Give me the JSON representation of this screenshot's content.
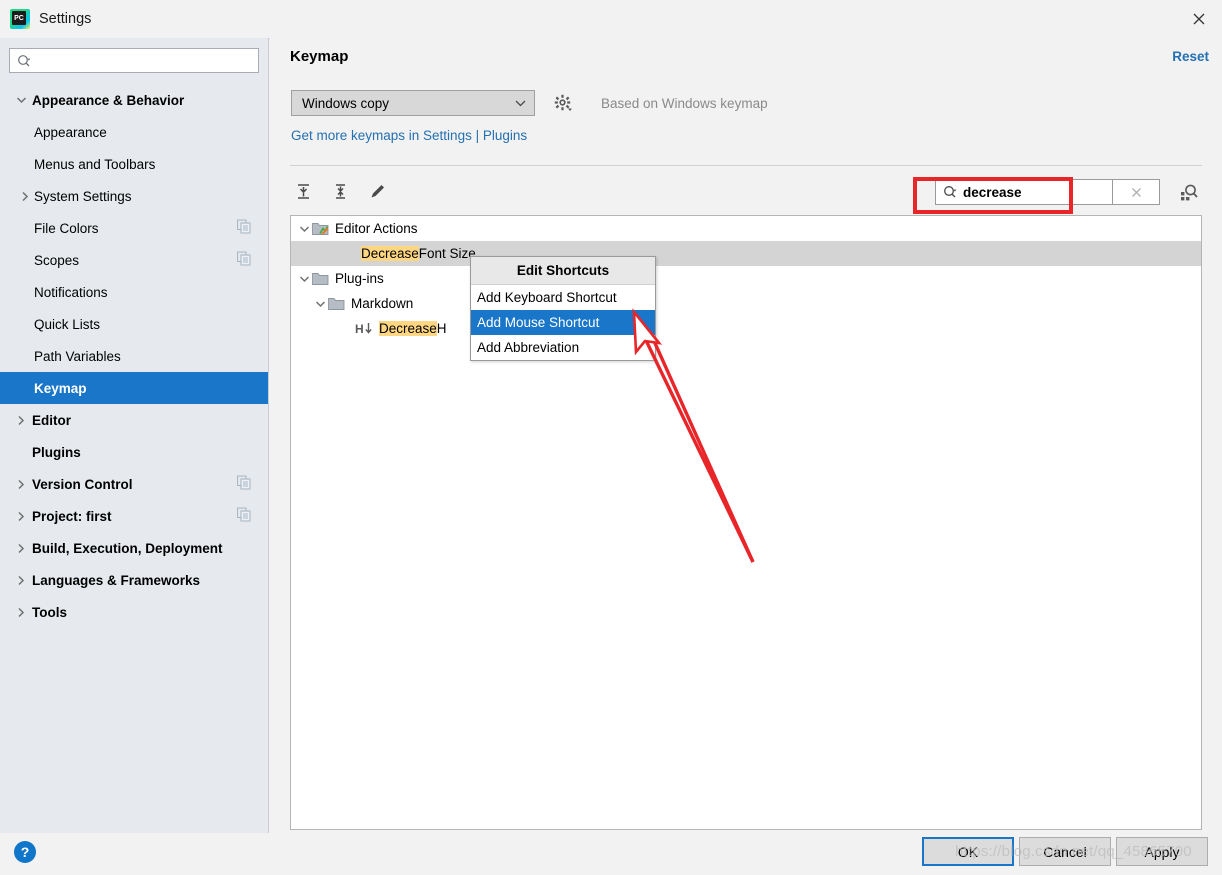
{
  "window": {
    "title": "Settings",
    "logo_icon": "pycharm-logo",
    "close_icon": "close-icon"
  },
  "sidebar": {
    "search": {
      "value": "",
      "placeholder": "",
      "icon": "search-icon"
    },
    "items": [
      {
        "label": "Appearance & Behavior",
        "level": 0,
        "bold": true,
        "arrow": "chevron-down",
        "selected": false,
        "badge": false
      },
      {
        "label": "Appearance",
        "level": 1,
        "bold": false,
        "arrow": "none",
        "selected": false,
        "badge": false
      },
      {
        "label": "Menus and Toolbars",
        "level": 1,
        "bold": false,
        "arrow": "none",
        "selected": false,
        "badge": false
      },
      {
        "label": "System Settings",
        "level": 1,
        "bold": false,
        "arrow": "chevron-right",
        "selected": false,
        "badge": false
      },
      {
        "label": "File Colors",
        "level": 1,
        "bold": false,
        "arrow": "none",
        "selected": false,
        "badge": true
      },
      {
        "label": "Scopes",
        "level": 1,
        "bold": false,
        "arrow": "none",
        "selected": false,
        "badge": true
      },
      {
        "label": "Notifications",
        "level": 1,
        "bold": false,
        "arrow": "none",
        "selected": false,
        "badge": false
      },
      {
        "label": "Quick Lists",
        "level": 1,
        "bold": false,
        "arrow": "none",
        "selected": false,
        "badge": false
      },
      {
        "label": "Path Variables",
        "level": 1,
        "bold": false,
        "arrow": "none",
        "selected": false,
        "badge": false
      },
      {
        "label": "Keymap",
        "level": 1,
        "bold": true,
        "arrow": "none",
        "selected": true,
        "badge": false
      },
      {
        "label": "Editor",
        "level": 0,
        "bold": true,
        "arrow": "chevron-right",
        "selected": false,
        "badge": false
      },
      {
        "label": "Plugins",
        "level": 0,
        "bold": true,
        "arrow": "none",
        "selected": false,
        "badge": false
      },
      {
        "label": "Version Control",
        "level": 0,
        "bold": true,
        "arrow": "chevron-right",
        "selected": false,
        "badge": true
      },
      {
        "label": "Project: first",
        "level": 0,
        "bold": true,
        "arrow": "chevron-right",
        "selected": false,
        "badge": true
      },
      {
        "label": "Build, Execution, Deployment",
        "level": 0,
        "bold": true,
        "arrow": "chevron-right",
        "selected": false,
        "badge": false
      },
      {
        "label": "Languages & Frameworks",
        "level": 0,
        "bold": true,
        "arrow": "chevron-right",
        "selected": false,
        "badge": false
      },
      {
        "label": "Tools",
        "level": 0,
        "bold": true,
        "arrow": "chevron-right",
        "selected": false,
        "badge": false
      }
    ]
  },
  "main": {
    "title": "Keymap",
    "reset_label": "Reset",
    "keymap_select": {
      "value": "Windows copy",
      "chevron_icon": "chevron-down-icon"
    },
    "gear_icon": "gear-icon",
    "based_on": "Based on Windows keymap",
    "plugins_link": "Get more keymaps in Settings | Plugins",
    "toolbar": [
      {
        "icon": "expand-all-icon"
      },
      {
        "icon": "collapse-all-icon"
      },
      {
        "icon": "edit-pencil-icon"
      }
    ],
    "find": {
      "value": "decrease",
      "search_icon": "search-icon",
      "clear_icon": "clear-x-icon",
      "shortcut_find_icon": "find-by-shortcut-icon"
    },
    "tree": [
      {
        "label": "Editor Actions",
        "highlight": "",
        "level": 0,
        "arrow": "chevron-down",
        "icon": "folder-editor-actions-icon",
        "selected": false
      },
      {
        "label": " Font Size",
        "highlight": "Decrease",
        "level": 1,
        "arrow": "none",
        "icon": "none",
        "selected": true
      },
      {
        "label": "Plug-ins",
        "highlight": "",
        "level": 0,
        "arrow": "chevron-down",
        "icon": "folder-icon",
        "selected": false
      },
      {
        "label": "Markdown",
        "highlight": "",
        "level": 2,
        "arrow": "chevron-down",
        "icon": "folder-icon",
        "selected": false
      },
      {
        "label": " H",
        "highlight": "Decrease",
        "level": 3,
        "arrow": "none",
        "icon": "heading-down-icon",
        "selected": false
      }
    ]
  },
  "context_menu": {
    "header": "Edit Shortcuts",
    "items": [
      {
        "label": "Add Keyboard Shortcut",
        "selected": false
      },
      {
        "label": "Add Mouse Shortcut",
        "selected": true
      },
      {
        "label": "Add Abbreviation",
        "selected": false
      }
    ]
  },
  "footer": {
    "help_label": "?",
    "buttons": [
      {
        "label": "OK",
        "focused": true
      },
      {
        "label": "Cancel",
        "focused": false
      },
      {
        "label": "Apply",
        "focused": false
      }
    ]
  },
  "watermark": "https://blog.csdn.net/qq_45865700",
  "annotations": {
    "red_box_target": "find-input",
    "red_arrow_target": "Add Mouse Shortcut",
    "accent_red": "#e8262a",
    "accent_blue": "#1976c8",
    "highlight_yellow": "#ffd782"
  }
}
